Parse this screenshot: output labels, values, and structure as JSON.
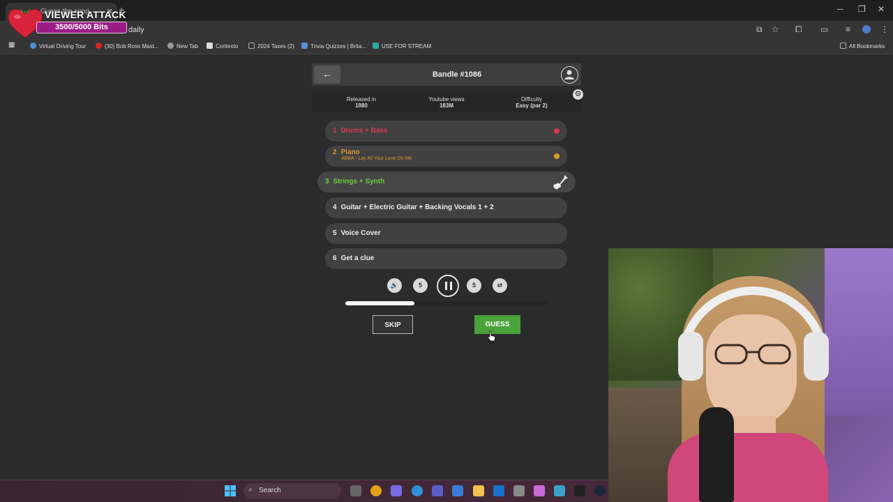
{
  "browser": {
    "tab_title": "Guess the song",
    "url_fragment": "daily",
    "bookmarks": [
      {
        "label": "Virtual Driving Tour",
        "color": "#4a8fd6"
      },
      {
        "label": "(30) Bob Ross Mast...",
        "color": "#e02020"
      },
      {
        "label": "New Tab",
        "color": "#999999"
      },
      {
        "label": "Contexto",
        "color": "#dddddd"
      },
      {
        "label": "2024 Taxes (2)",
        "color": "#888888"
      },
      {
        "label": "Trivia Quizzes | Brita...",
        "color": "#5b8dd6"
      },
      {
        "label": "USE FOR STREAM",
        "color": "#2aa8a8"
      }
    ],
    "all_bookmarks": "All Bookmarks"
  },
  "overlay": {
    "title": "VIEWER ATTACK",
    "bits": "3500/5000 Bits"
  },
  "game": {
    "title": "Bandle #1086",
    "info": [
      {
        "label": "Released in",
        "value": "1980"
      },
      {
        "label": "Youtube views",
        "value": "183M"
      },
      {
        "label": "Difficulty",
        "value": "Easy (par 2)"
      }
    ],
    "stems": [
      {
        "num": "1",
        "label": "Drums + Bass",
        "state": "wrong"
      },
      {
        "num": "2",
        "label": "Piano",
        "sub": "ABBA - Lay All Your Love On Me",
        "state": "partial"
      },
      {
        "num": "3",
        "label": "Strings + Synth",
        "state": "active"
      },
      {
        "num": "4",
        "label": "Guitar + Electric Guitar + Backing Vocals 1 + 2",
        "state": "locked"
      },
      {
        "num": "5",
        "label": "Voice Cover",
        "state": "locked"
      },
      {
        "num": "6",
        "label": "Get a clue",
        "state": "locked"
      }
    ],
    "controls": {
      "rewind_label": "5",
      "forward_label": "5",
      "progress": 0.34
    },
    "skip_label": "SKIP",
    "guess_label": "GUESS",
    "colors": {
      "wrong": "#d63a4b",
      "partial": "#d9962a",
      "active": "#6ecb3c",
      "guess_button": "#4aa23a"
    }
  },
  "taskbar": {
    "search_label": "Search"
  }
}
